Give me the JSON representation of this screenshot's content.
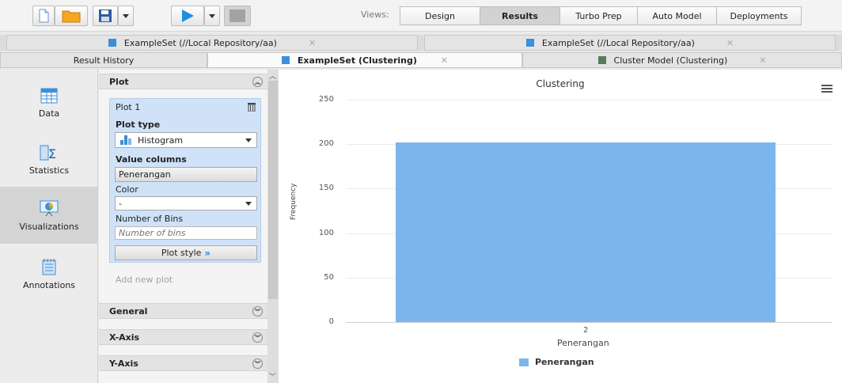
{
  "toolbar": {
    "views_label": "Views:",
    "views": [
      "Design",
      "Results",
      "Turbo Prep",
      "Auto Model",
      "Deployments"
    ],
    "active_view": "Results"
  },
  "tabs_row1": [
    {
      "label": "ExampleSet (//Local Repository/aa)"
    },
    {
      "label": "ExampleSet (//Local Repository/aa)"
    }
  ],
  "tabs_row2": {
    "history": "Result History",
    "active": "ExampleSet (Clustering)",
    "other": "Cluster Model (Clustering)"
  },
  "leftnav": [
    "Data",
    "Statistics",
    "Visualizations",
    "Annotations"
  ],
  "panel": {
    "plot_section": "Plot",
    "plot_name": "Plot 1",
    "plot_type_label": "Plot type",
    "plot_type_value": "Histogram",
    "value_columns_label": "Value columns",
    "value_column": "Penerangan",
    "color_label": "Color",
    "color_value": "-",
    "bins_label": "Number of Bins",
    "bins_placeholder": "Number of bins",
    "plot_style_label": "Plot style",
    "add_plot": "Add new plot",
    "general": "General",
    "x_axis": "X-Axis",
    "y_axis": "Y-Axis"
  },
  "colors": {
    "bar": "#7cb5ec",
    "accent": "#1e8fe1"
  },
  "chart_data": {
    "type": "bar",
    "title": "Clustering",
    "xlabel": "Penerangan",
    "ylabel": "Frequency",
    "categories": [
      "2"
    ],
    "series": [
      {
        "name": "Penerangan",
        "values": [
          202
        ]
      }
    ],
    "ylim": [
      0,
      250
    ],
    "yticks": [
      0,
      50,
      100,
      150,
      200,
      250
    ],
    "grid": true,
    "legend": "bottom"
  }
}
